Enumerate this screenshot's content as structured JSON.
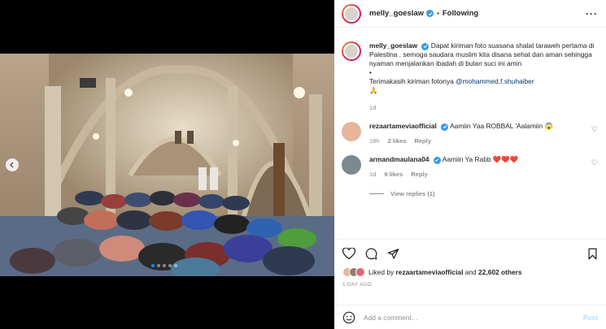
{
  "post": {
    "username": "melly_goeslaw",
    "following_label": "Following",
    "caption_line1": "Dapat kiriman foto suasana shalat taraweh pertama di Palestina . semoga saudara muslim kita disana sehat dan aman sehingga nyaman menjalankan ibadah di bulan suci ini amin",
    "caption_bullet": "•",
    "caption_thanks": "Terimakasih kiriman fotonya",
    "caption_mention": "@mohammed.f.shuhaiber",
    "caption_emoji": "🙏",
    "caption_age": "1d"
  },
  "comments": [
    {
      "username": "rezaartameviaofficial",
      "text": "Aamiin Yaa ROBBAL 'Aalamiin 😱",
      "age": "18h",
      "likes": "2 likes",
      "reply": "Reply",
      "avatar_color": "#e7b59a"
    },
    {
      "username": "armandmaulana04",
      "text": "Aamiin Ya Rabb ❤️❤️❤️",
      "age": "1d",
      "likes": "9 likes",
      "reply": "Reply",
      "avatar_color": "#7c8a8f"
    }
  ],
  "view_replies": "View replies (1)",
  "likes": {
    "prefix": "Liked by",
    "user": "rezaartameviaofficial",
    "and": "and",
    "others": "22,602 others"
  },
  "time_ago": "1 DAY AGO",
  "add_comment": {
    "placeholder": "Add a comment…",
    "post_label": "Post"
  },
  "carousel": {
    "dot_count": 5,
    "active_index": 0
  },
  "colors": {
    "verified": "#3897f0",
    "link": "#00376b",
    "post_disabled": "#b2dffc"
  }
}
